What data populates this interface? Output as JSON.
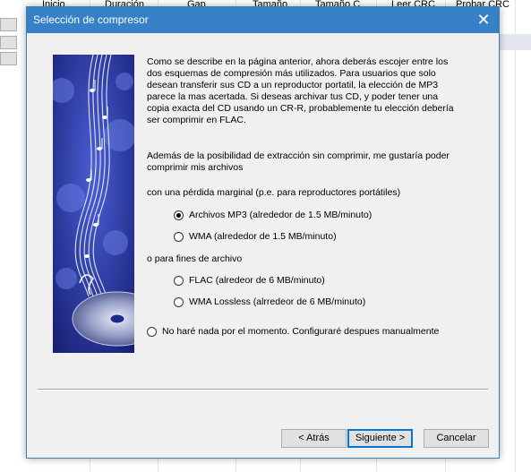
{
  "background_app": {
    "columns": [
      "Inicio",
      "Duración",
      "Gap",
      "Tamaño",
      "Tamaño C",
      "Leer CRC",
      "Probar CRC"
    ]
  },
  "dialog": {
    "title": "Selección de compresor",
    "close_label": "✕",
    "intro": "Como se describe en la página anterior, ahora deberás escojer entre los dos esquemas de compresión más utilizados. Para usuarios que solo desean transferir sus CD a un reproductor portatil, la elección de MP3 parece la mas acertada. Si deseas archivar tus CD, y poder tener una copia exacta del CD usando un CR-R, probablemente tu elección debería ser comprimir en FLAC.",
    "question": "Además de la posibilidad de extracción sin comprimir, me gustaría poder comprimir mis archivos",
    "group_lossy_label": "con una pérdida marginal (p.e. para reproductores portátiles)",
    "group_archive_label": "o para fines de archivo",
    "options": {
      "mp3": "Archivos MP3 (alrededor de 1.5 MB/minuto)",
      "wma": "WMA (alrededor de 1.5 MB/minuto)",
      "flac": "FLAC (alredeor de 6 MB/minuto)",
      "wma_lossless": "WMA Lossless (alrredeor de 6 MB/minuto)",
      "none": "No haré nada por el momento. Configuraré despues manualmente"
    },
    "selected_option": "mp3",
    "buttons": {
      "back": "< Atrás",
      "next": "Siguiente >",
      "cancel": "Cancelar"
    }
  }
}
